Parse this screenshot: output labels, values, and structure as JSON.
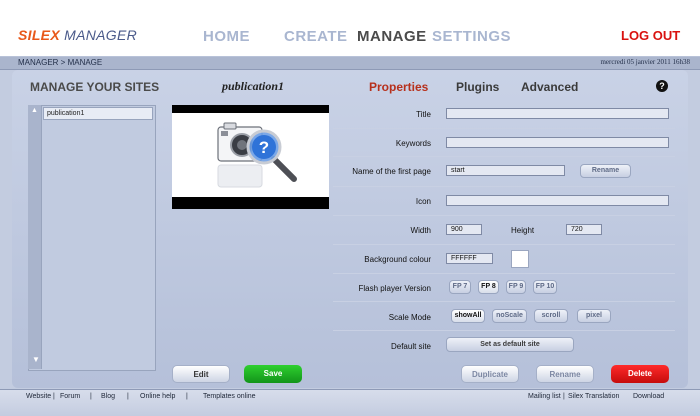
{
  "header": {
    "logo_part1": "SILEX",
    "logo_part2": " MANAGER",
    "nav": [
      "HOME",
      "CREATE",
      "MANAGE",
      "SETTINGS"
    ],
    "active_nav": "MANAGE",
    "logout": "LOG OUT"
  },
  "breadcrumb": "MANAGER > MANAGE",
  "date": "mercredi 05 janvier 2011 16h38",
  "sites": {
    "title": "MANAGE YOUR SITES",
    "items": [
      "publication1"
    ]
  },
  "publication": {
    "title": "publication1",
    "preview_icon": "camera-search-icon"
  },
  "tabs": [
    "Properties",
    "Plugins",
    "Advanced"
  ],
  "active_tab": "Properties",
  "help_label": "?",
  "properties": {
    "title_label": "Title",
    "title_value": "",
    "keywords_label": "Keywords",
    "keywords_value": "",
    "first_page_label": "Name of the first page",
    "first_page_value": "start",
    "rename_button": "Rename",
    "icon_label": "Icon",
    "icon_value": "",
    "width_label": "Width",
    "width_value": "900",
    "height_label": "Height",
    "height_value": "720",
    "bg_label": "Background colour",
    "bg_value": "FFFFFF",
    "bg_color": "#ffffff",
    "flash_label": "Flash player Version",
    "flash_options": [
      "FP 7",
      "FP 8",
      "FP 9",
      "FP 10"
    ],
    "flash_selected": "FP 8",
    "scale_label": "Scale Mode",
    "scale_options": [
      "showAll",
      "noScale",
      "scroll",
      "pixel"
    ],
    "scale_selected": "showAll",
    "default_label": "Default site",
    "default_button": "Set as default site"
  },
  "actions": {
    "edit": "Edit",
    "save": "Save",
    "duplicate": "Duplicate",
    "rename": "Rename",
    "delete": "Delete"
  },
  "footer": {
    "left": [
      "Website",
      "Forum",
      "Blog",
      "Online help",
      "Templates online"
    ],
    "right": [
      "Mailing list",
      "Silex Translation",
      "Download"
    ]
  },
  "colors": {
    "accent_orange": "#e8581a",
    "logout_red": "#d9120f",
    "save_green": "#1fb31f",
    "delete_red": "#e01414"
  }
}
